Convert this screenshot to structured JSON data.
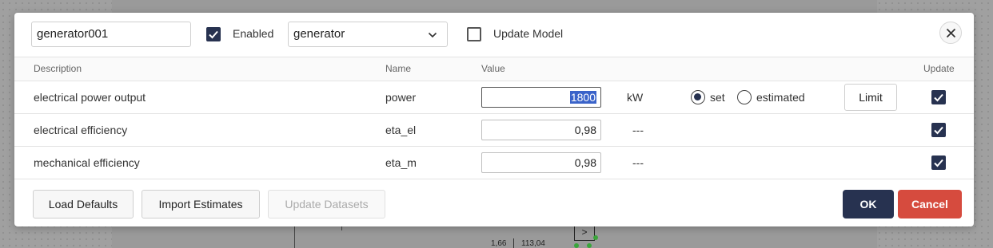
{
  "colors": {
    "primary": "#273250",
    "danger": "#d64b3e",
    "selection": "#3a63c9"
  },
  "background": {
    "labels": [
      "1,66",
      "113,04"
    ]
  },
  "header": {
    "name_value": "generator001",
    "enabled_label": "Enabled",
    "enabled_checked": true,
    "type_value": "generator",
    "update_model_label": "Update Model",
    "update_model_checked": false,
    "close_icon": "close-icon"
  },
  "table": {
    "columns": {
      "description": "Description",
      "name": "Name",
      "value": "Value",
      "update": "Update"
    },
    "rows": [
      {
        "description": "electrical power output",
        "name": "power",
        "value": "1800",
        "unit": "kW",
        "radio_set_label": "set",
        "radio_estimated_label": "estimated",
        "selected_mode": "set",
        "limit_label": "Limit",
        "update_checked": true
      },
      {
        "description": "electrical efficiency",
        "name": "eta_el",
        "value": "0,98",
        "unit": "---",
        "update_checked": true
      },
      {
        "description": "mechanical efficiency",
        "name": "eta_m",
        "value": "0,98",
        "unit": "---",
        "update_checked": true
      }
    ]
  },
  "footer": {
    "load_defaults": "Load Defaults",
    "import_estimates": "Import Estimates",
    "update_datasets": "Update Datasets",
    "ok": "OK",
    "cancel": "Cancel"
  }
}
